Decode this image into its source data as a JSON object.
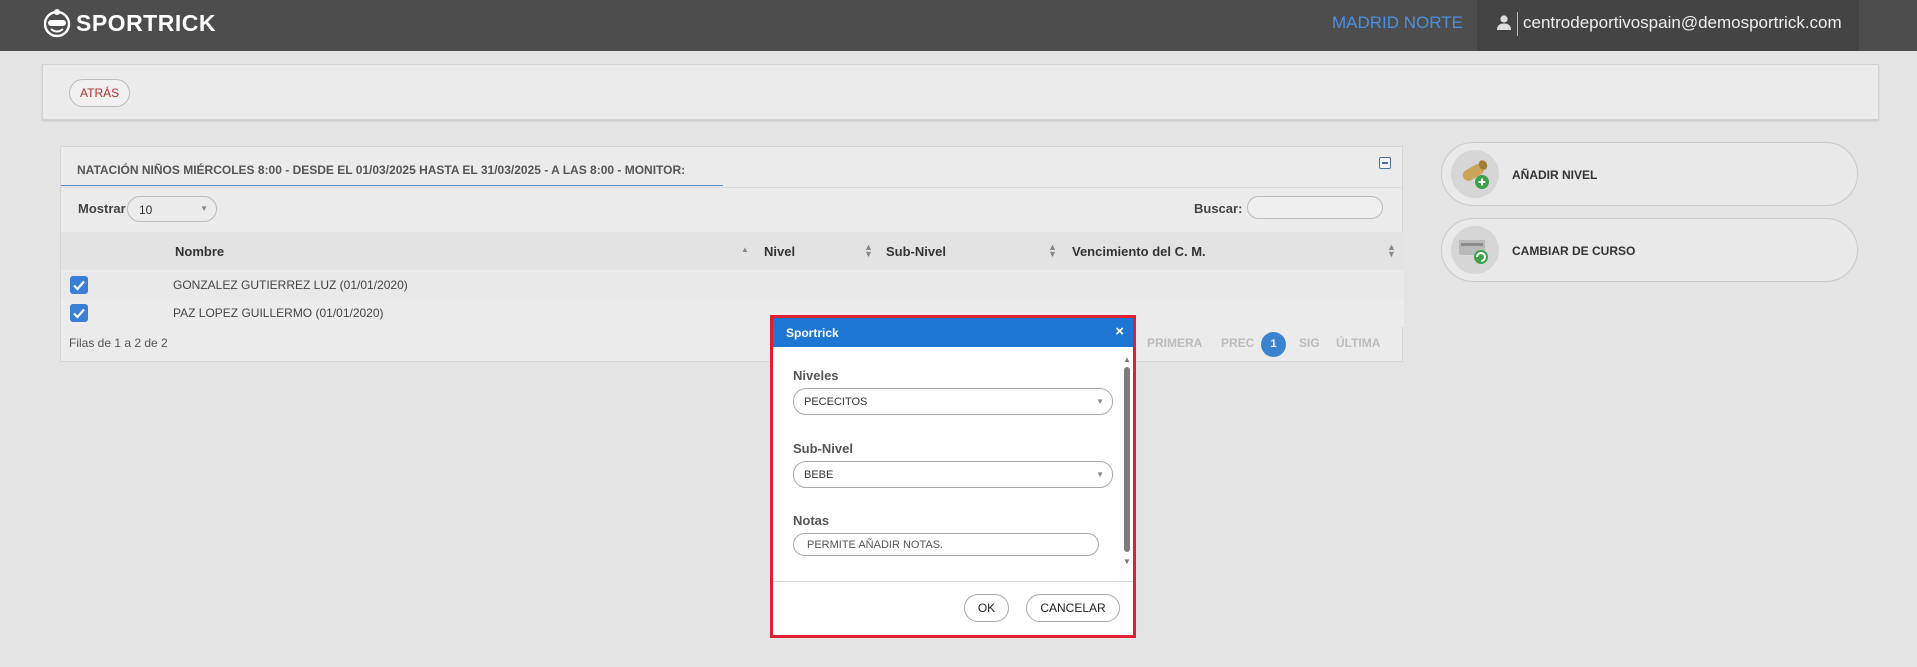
{
  "topbar": {
    "brand": "SPORTRICK",
    "club": "MADRID NORTE",
    "email": "centrodeportivospain@demosportrick.com"
  },
  "header": {
    "back_label": "ATRÁS"
  },
  "list": {
    "title": "NATACIÓN NIÑOS MIÉRCOLES 8:00 - DESDE EL 01/03/2025 HASTA EL 31/03/2025 - A LAS 8:00 - MONITOR:",
    "show_label": "Mostrar",
    "show_value": "10",
    "search_label": "Buscar:",
    "search_value": "",
    "columns": [
      "Nombre",
      "Nivel",
      "Sub-Nivel",
      "Vencimiento del C. M."
    ],
    "rows": [
      {
        "checked": true,
        "name": "GONZALEZ GUTIERREZ LUZ (01/01/2020)"
      },
      {
        "checked": true,
        "name": "PAZ LOPEZ GUILLERMO (01/01/2020)"
      }
    ],
    "footer_info": "Filas de 1 a 2 de 2",
    "pager": {
      "first": "PRIMERA",
      "prev": "PREC",
      "current": "1",
      "next": "SIG",
      "last": "ÚLTIMA"
    }
  },
  "actions": [
    {
      "label": "AÑADIR NIVEL",
      "icon": "scroll-add-icon"
    },
    {
      "label": "CAMBIAR DE CURSO",
      "icon": "transfer-icon"
    }
  ],
  "modal": {
    "title": "Sportrick",
    "close": "×",
    "niveles_label": "Niveles",
    "niveles_value": "PECECITOS",
    "subnivel_label": "Sub-Nivel",
    "subnivel_value": "BEBE",
    "notas_label": "Notas",
    "notas_value": "PERMITE AÑADIR NOTAS.",
    "ok_label": "OK",
    "cancel_label": "CANCELAR"
  },
  "colors": {
    "topbar": "#4d4d4d",
    "accent": "#1d76d2",
    "club_link": "#4a90e2",
    "modal_highlight": "#e0202e"
  }
}
